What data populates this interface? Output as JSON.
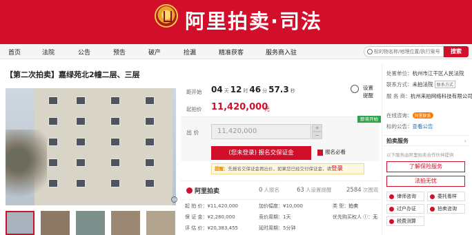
{
  "banner": {
    "brand": "阿里拍卖·司法"
  },
  "nav": {
    "items": [
      "首页",
      "法院",
      "公告",
      "预告",
      "破产",
      "捡漏",
      "精准获客",
      "服务商入驻"
    ],
    "search_placeholder": "标的物名称/地理位置/执行案号",
    "search_button": "搜索"
  },
  "item": {
    "title": "【第二次拍卖】嘉绿苑北2幢二层、三层",
    "countdown_label": "距开始",
    "countdown": {
      "days": "04",
      "days_u": "天",
      "hours": "12",
      "hours_u": "时",
      "minutes": "46",
      "minutes_u": "分",
      "seconds": "57.3",
      "seconds_u": "秒"
    },
    "remind_label": "设置提醒",
    "start_price_label": "起拍价",
    "start_price": "11,420,000",
    "price_unit": "元",
    "open_badge": "即将开始",
    "bid_label": "出  价",
    "bid_value": "11,420,000",
    "stepper_plus": "+",
    "stepper_minus": "−",
    "signup_button": "(您未登录) 报名交保证金",
    "must_read": "报名必看",
    "tip_prefix": "提醒：",
    "tip_text": "先报名交保证金再出价，如果您已经交付保证金，请",
    "tip_login": "登录",
    "platform_logo": "阿里拍卖",
    "stats": [
      {
        "num": "0",
        "label": "人报名"
      },
      {
        "num": "63",
        "label": "人设置提醒"
      },
      {
        "num": "2584",
        "label": "次围观"
      }
    ],
    "details": {
      "start_price": "起 拍 价：¥11,420,000",
      "increment": "加价幅度：¥10,000",
      "type": "类    型：",
      "type_val": "拍卖",
      "deposit": "保 证 金：¥2,280,000",
      "period": "竞价周期：1天",
      "priority": "优先购买权人",
      "priority_val": "无",
      "assess": "评 估 价：¥20,383,455",
      "delay": "延时周期：5分钟"
    }
  },
  "right_panel": {
    "court_label": "处置单位：",
    "court": "杭州市江干区人民法院",
    "contact_label": "联系方式：",
    "contact_val": "未拍法院",
    "contact_tag": "联系方式",
    "service_label": "服     务 商：",
    "service": "杭州来拍网络科技有限公司",
    "online_label": "在线咨询：",
    "online_tag": "阿里联系",
    "announce_label": "标的公告：",
    "announce": "查看公告",
    "auction_service": "拍卖服务",
    "service_note": "以下服务由阿里拍卖合作伙伴提供",
    "btn_insurance": "了解保险服务",
    "btn_loan": "法拍无忧",
    "svc": [
      "律师咨询",
      "委托看样",
      "过户办证",
      "拍卖咨询",
      "税费测算"
    ]
  }
}
